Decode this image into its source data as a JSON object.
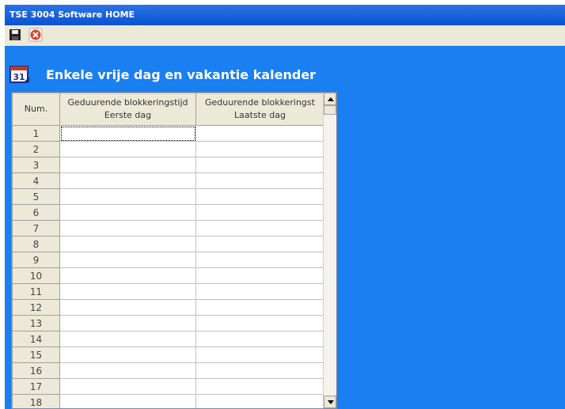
{
  "window": {
    "title": "TSE 3004 Software HOME"
  },
  "toolbar": {
    "save_icon": "floppy-disk-icon",
    "close_icon": "close-x-icon"
  },
  "header": {
    "title": "Enkele vrije dag en vakantie kalender",
    "icon": "calendar-icon"
  },
  "colors": {
    "background": "#1a7ff0",
    "titlebar": "#0c5bd8",
    "chrome": "#ece9d8"
  },
  "table": {
    "headers": {
      "num": "Num.",
      "col1_line1": "Geduurende blokkeringstijd",
      "col1_line2": "Eerste dag",
      "col2_line1": "Geduurende blokkeringst",
      "col2_line2": "Laatste dag"
    },
    "rows": [
      "1",
      "2",
      "3",
      "4",
      "5",
      "6",
      "7",
      "8",
      "9",
      "10",
      "11",
      "12",
      "13",
      "14",
      "15",
      "16",
      "17",
      "18"
    ]
  }
}
